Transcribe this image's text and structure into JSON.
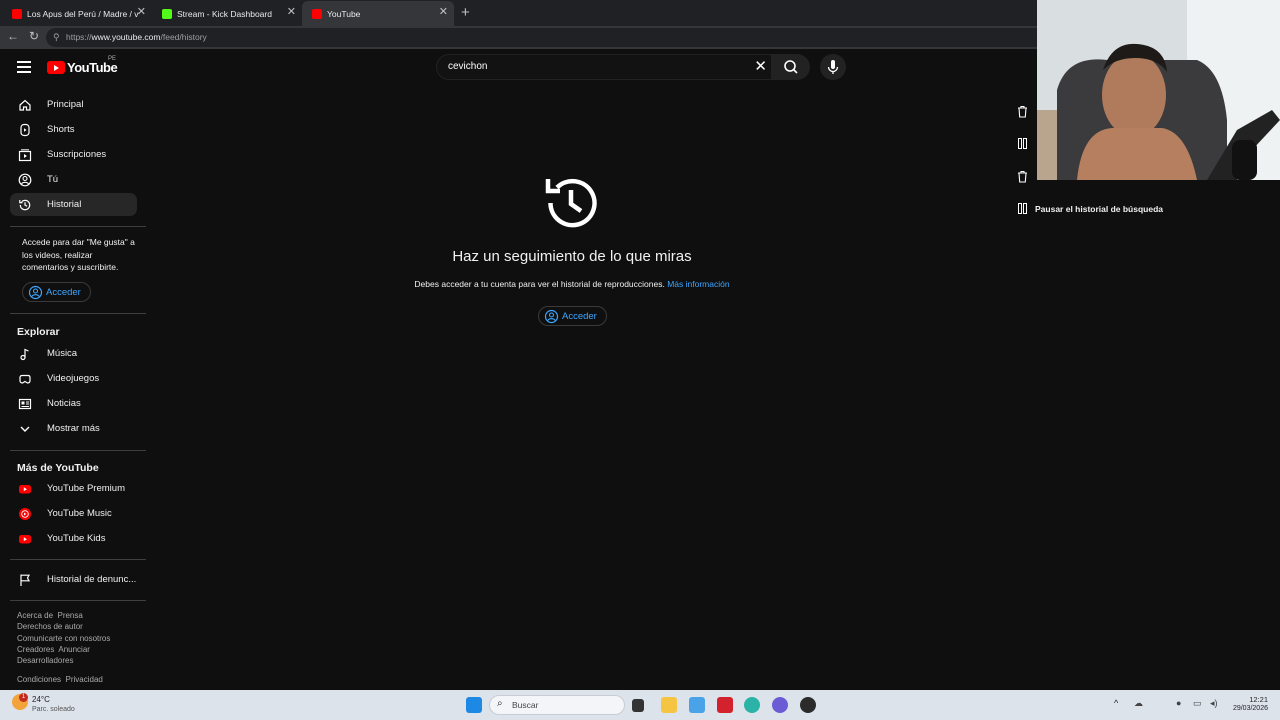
{
  "tabs": [
    {
      "title": "Los Apus del Perú / Madre / video",
      "color": "#ff0000"
    },
    {
      "title": "Stream - Kick Dashboard",
      "color": "#53fc18"
    },
    {
      "title": "YouTube",
      "color": "#ff0000"
    }
  ],
  "address": {
    "prefix": "https://",
    "domain": "www.youtube.com",
    "path": "/feed/history"
  },
  "header": {
    "logo": "YouTube",
    "country": "PE",
    "search_value": "cevichon"
  },
  "sidebar": {
    "main": [
      {
        "label": "Principal",
        "icon": "home-icon"
      },
      {
        "label": "Shorts",
        "icon": "shorts-icon"
      },
      {
        "label": "Suscripciones",
        "icon": "subscriptions-icon"
      },
      {
        "label": "Tú",
        "icon": "you-icon"
      },
      {
        "label": "Historial",
        "icon": "history-icon",
        "selected": true
      }
    ],
    "signin_prompt": "Accede para dar \"Me gusta\" a los videos, realizar comentarios y suscribirte.",
    "signin_label": "Acceder",
    "explore_title": "Explorar",
    "explore": [
      {
        "label": "Música",
        "icon": "music-icon"
      },
      {
        "label": "Videojuegos",
        "icon": "gaming-icon"
      },
      {
        "label": "Noticias",
        "icon": "news-icon"
      },
      {
        "label": "Mostrar más",
        "icon": "chevron-down-icon"
      }
    ],
    "more_title": "Más de YouTube",
    "more": [
      {
        "label": "YouTube Premium",
        "icon": "youtube-premium-icon"
      },
      {
        "label": "YouTube Music",
        "icon": "youtube-music-icon"
      },
      {
        "label": "YouTube Kids",
        "icon": "youtube-kids-icon"
      }
    ],
    "report_label": "Historial de denunc...",
    "footer1": [
      "Acerca de",
      "Prensa",
      "Derechos de autor",
      "Comunicarte con nosotros",
      "Creadores",
      "Anunciar",
      "Desarrolladores"
    ],
    "footer2": [
      "Condiciones",
      "Privacidad"
    ]
  },
  "main": {
    "title": "Haz un seguimiento de lo que miras",
    "desc": "Debes acceder a tu cuenta para ver el historial de reproducciones.",
    "link": "Más información",
    "signin_label": "Acceder"
  },
  "right_panel": {
    "pause_label": "Pausar el historial de búsqueda"
  },
  "taskbar": {
    "temp": "24°C",
    "weather": "Parc. soleado",
    "search_placeholder": "Buscar",
    "time": "12:21",
    "date": "29/03/2026",
    "badge": "1"
  },
  "colors": {
    "accent": "#3ea6ff",
    "brand": "#ff0000",
    "background": "#0f0f0f"
  }
}
